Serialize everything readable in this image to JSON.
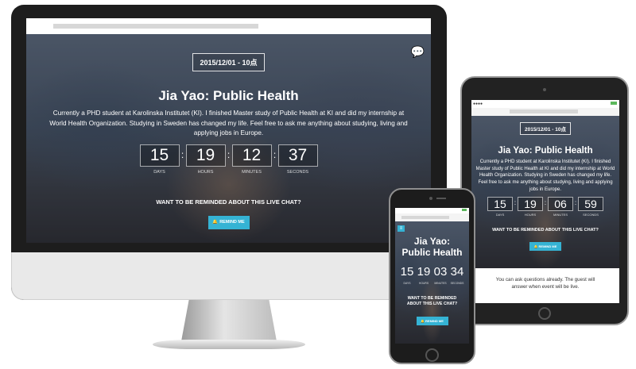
{
  "event": {
    "date": "2015/12/01 - 10点",
    "title": "Jia Yao: Public Health",
    "phone_title": [
      "Jia Yao:",
      "Public Health"
    ],
    "description": "Currently a PHD student at Karolinska Institutet (KI). I finished Master study of Public Health at KI and did my internship at World Health Organization. Studying in Sweden has changed my life. Feel free to ask me anything about studying, living and applying jobs in Europe.",
    "remind_question": "Want to be reminded about this live chat?",
    "remind_button": "REMIND ME",
    "note": "You can ask questions already. The guest will answer when event will be live."
  },
  "countdown_labels": {
    "days": "DAYS",
    "hours": "HOURS",
    "minutes": "MINUTES",
    "seconds": "SECONDS"
  },
  "desktop": {
    "countdown": {
      "days": "15",
      "hours": "19",
      "minutes": "12",
      "seconds": "37"
    }
  },
  "tablet": {
    "countdown": {
      "days": "15",
      "hours": "19",
      "minutes": "06",
      "seconds": "59"
    }
  },
  "phone": {
    "countdown": {
      "days": "15",
      "hours": "19",
      "minutes": "03",
      "seconds": "34"
    }
  },
  "icons": {
    "chat": "chat-bubbles-icon",
    "bell": "bell-icon",
    "menu": "hamburger-menu-icon"
  },
  "colors": {
    "accent": "#35b3d4",
    "bezel": "#1d1d1d"
  }
}
